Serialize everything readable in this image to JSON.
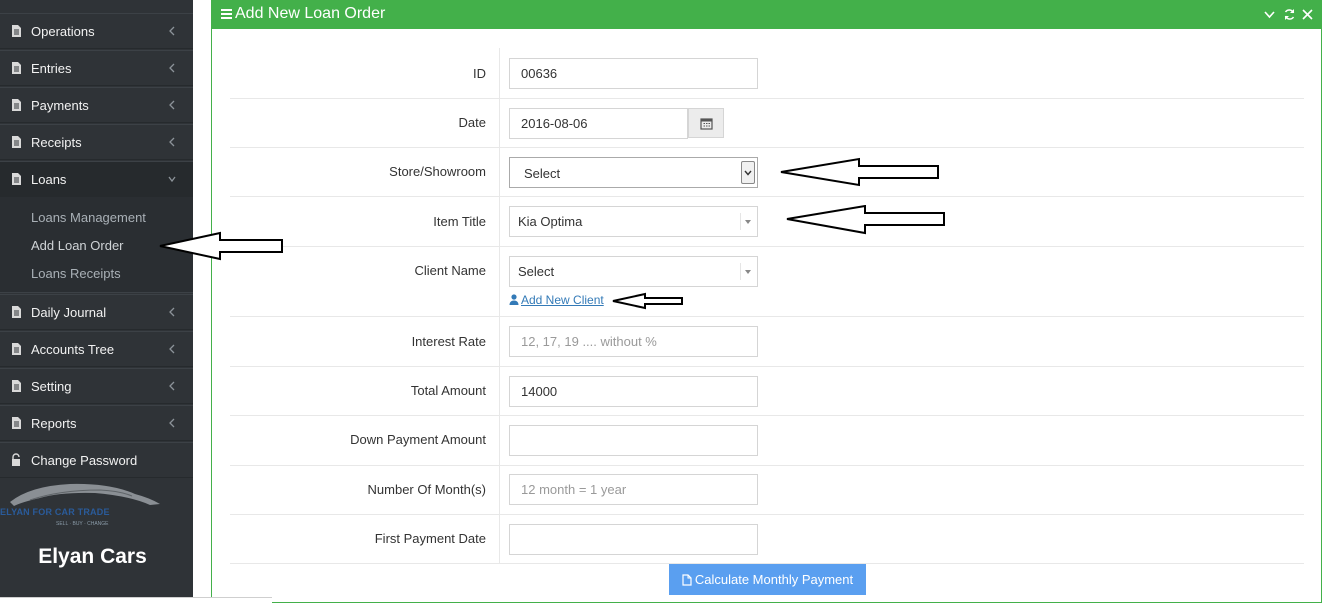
{
  "sidebar": {
    "items": [
      {
        "label": "Operations",
        "icon": "file-icon"
      },
      {
        "label": "Entries",
        "icon": "file-icon"
      },
      {
        "label": "Payments",
        "icon": "file-icon"
      },
      {
        "label": "Receipts",
        "icon": "file-icon"
      },
      {
        "label": "Loans",
        "icon": "file-icon"
      },
      {
        "label": "Daily Journal",
        "icon": "file-icon"
      },
      {
        "label": "Accounts Tree",
        "icon": "file-icon"
      },
      {
        "label": "Setting",
        "icon": "file-icon"
      },
      {
        "label": "Reports",
        "icon": "file-icon"
      },
      {
        "label": "Change Password",
        "icon": "unlock-icon"
      }
    ],
    "loans_submenu": [
      "Loans Management",
      "Add Loan Order",
      "Loans Receipts"
    ],
    "logo_text": "ELYAN FOR CAR TRADE",
    "logo_sub": "SELL · BUY · CHANGE",
    "brand": "Elyan Cars"
  },
  "panel": {
    "title": "Add New Loan Order",
    "accent": "#43b04a"
  },
  "form": {
    "id_label": "ID",
    "id_value": "00636",
    "date_label": "Date",
    "date_value": "2016-08-06",
    "store_label": "Store/Showroom",
    "store_value": "Select",
    "item_label": "Item Title",
    "item_value": "Kia Optima",
    "client_label": "Client Name",
    "client_value": "Select",
    "add_client_link": "Add New Client",
    "interest_label": "Interest Rate",
    "interest_placeholder": "12, 17, 19 .... without %",
    "total_label": "Total Amount",
    "total_value": "14000",
    "down_label": "Down Payment Amount",
    "down_value": "",
    "months_label": "Number Of Month(s)",
    "months_placeholder": "12 month = 1 year",
    "first_label": "First Payment Date",
    "first_value": "",
    "calc_button": "Calculate Monthly Payment",
    "button_color": "#5a9ff0"
  }
}
